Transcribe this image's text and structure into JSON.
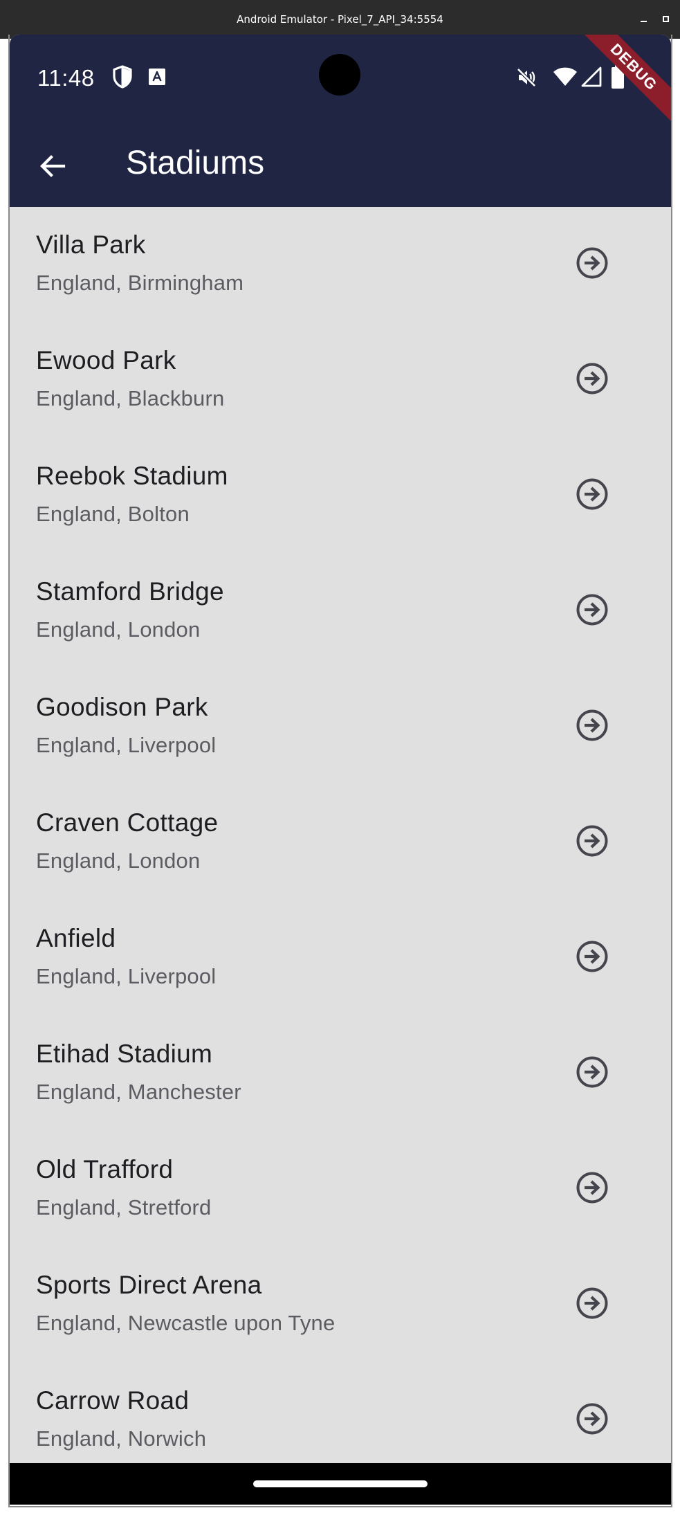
{
  "window": {
    "title": "Android Emulator - Pixel_7_API_34:5554"
  },
  "status_bar": {
    "time": "11:48"
  },
  "debug_banner": "DEBUG",
  "app_bar": {
    "title": "Stadiums"
  },
  "stadiums": [
    {
      "name": "Villa Park",
      "location": "England, Birmingham"
    },
    {
      "name": "Ewood Park",
      "location": "England, Blackburn"
    },
    {
      "name": "Reebok Stadium",
      "location": "England, Bolton"
    },
    {
      "name": "Stamford Bridge",
      "location": "England, London"
    },
    {
      "name": "Goodison Park",
      "location": "England, Liverpool"
    },
    {
      "name": "Craven Cottage",
      "location": "England, London"
    },
    {
      "name": "Anfield",
      "location": "England, Liverpool"
    },
    {
      "name": "Etihad Stadium",
      "location": "England, Manchester"
    },
    {
      "name": "Old Trafford",
      "location": "England, Stretford"
    },
    {
      "name": "Sports Direct Arena",
      "location": "England, Newcastle upon Tyne"
    },
    {
      "name": "Carrow Road",
      "location": "England, Norwich"
    }
  ],
  "colors": {
    "app_bar": "#1f2543",
    "list_background": "#e0e0e0",
    "debug_banner": "#8c1d2a",
    "arrow_icon": "#45454d"
  },
  "icons": {
    "back": "arrow-left-icon",
    "item_action": "arrow-circle-right-icon"
  }
}
